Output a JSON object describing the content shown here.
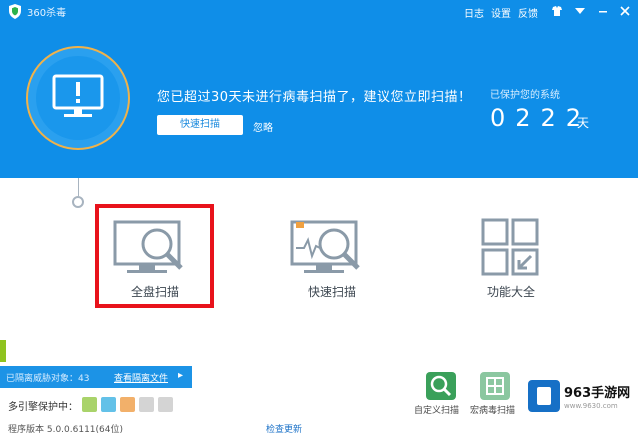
{
  "titlebar": {
    "app_title": "360杀毒",
    "links": [
      "日志",
      "设置",
      "反馈"
    ]
  },
  "header": {
    "headline": "您已超过30天未进行病毒扫描了，建议您立即扫描！",
    "quick_scan_button": "快速扫描",
    "ignore_link": "忽略",
    "protect_label": "已保护您的系统",
    "days_value": "0222",
    "days_unit": "天"
  },
  "tiles": [
    {
      "label": "全盘扫描",
      "icon": "monitor-magnifier-icon"
    },
    {
      "label": "快速扫描",
      "icon": "monitor-pulse-magnifier-icon"
    },
    {
      "label": "功能大全",
      "icon": "grid-arrow-icon"
    }
  ],
  "bottom": {
    "scan_bar_text": "已隔离威胁对象：43",
    "scan_bar_link": "查看隔离文件",
    "engine_label": "多引擎保护中：",
    "version_text": "程序版本 5.0.0.6111(64位)",
    "update_link": "检查更新",
    "tools": [
      "自定义扫描",
      "宏病毒扫描"
    ]
  },
  "watermark": {
    "title": "963手游网",
    "url": "www.9630.com"
  },
  "colors": {
    "header_blue": "#0f8ee8",
    "highlight_red": "#e8121b",
    "ring_orange": "#f0b24a"
  }
}
